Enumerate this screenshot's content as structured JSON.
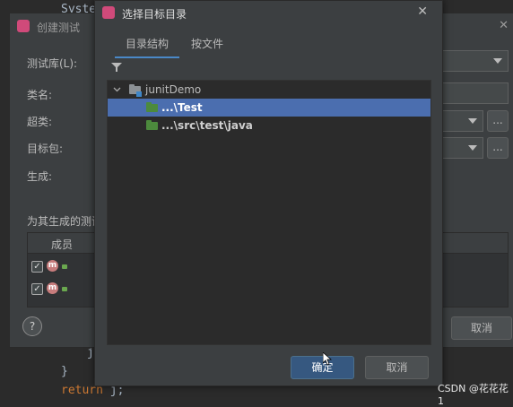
{
  "editor": {
    "line1": "Syste",
    "line2_brace": "}",
    "line3_keyword": "return",
    "line3_rest": " j;"
  },
  "back_dialog": {
    "title": "创建测试",
    "labels": {
      "testing_library": "测试库(L):",
      "class_name": "类名:",
      "superclass": "超类:",
      "target_package": "目标包:",
      "generate": "生成:",
      "generate_tests_for": "为其生成的测试"
    },
    "browse_label": "...",
    "member_column": "成员",
    "member_row_checked": "✓",
    "method_badge": "m",
    "cancel_label": "取消",
    "help_label": "?"
  },
  "front_dialog": {
    "title": "选择目标目录",
    "close_label": "✕",
    "tabs": [
      {
        "label": "目录结构",
        "active": true
      },
      {
        "label": "按文件",
        "active": false
      }
    ],
    "tree": {
      "root": {
        "label": "junitDemo",
        "expanded": true
      },
      "children": [
        {
          "label": "...\\Test",
          "selected": true
        },
        {
          "label": "...\\src\\test\\java",
          "selected": false
        }
      ]
    },
    "ok_label": "确定",
    "cancel_label": "取消"
  },
  "watermark": "CSDN @花花花1",
  "colors": {
    "selection": "#4b6eaf",
    "primary_button": "#365880",
    "folder_green": "#4c8a3d"
  }
}
